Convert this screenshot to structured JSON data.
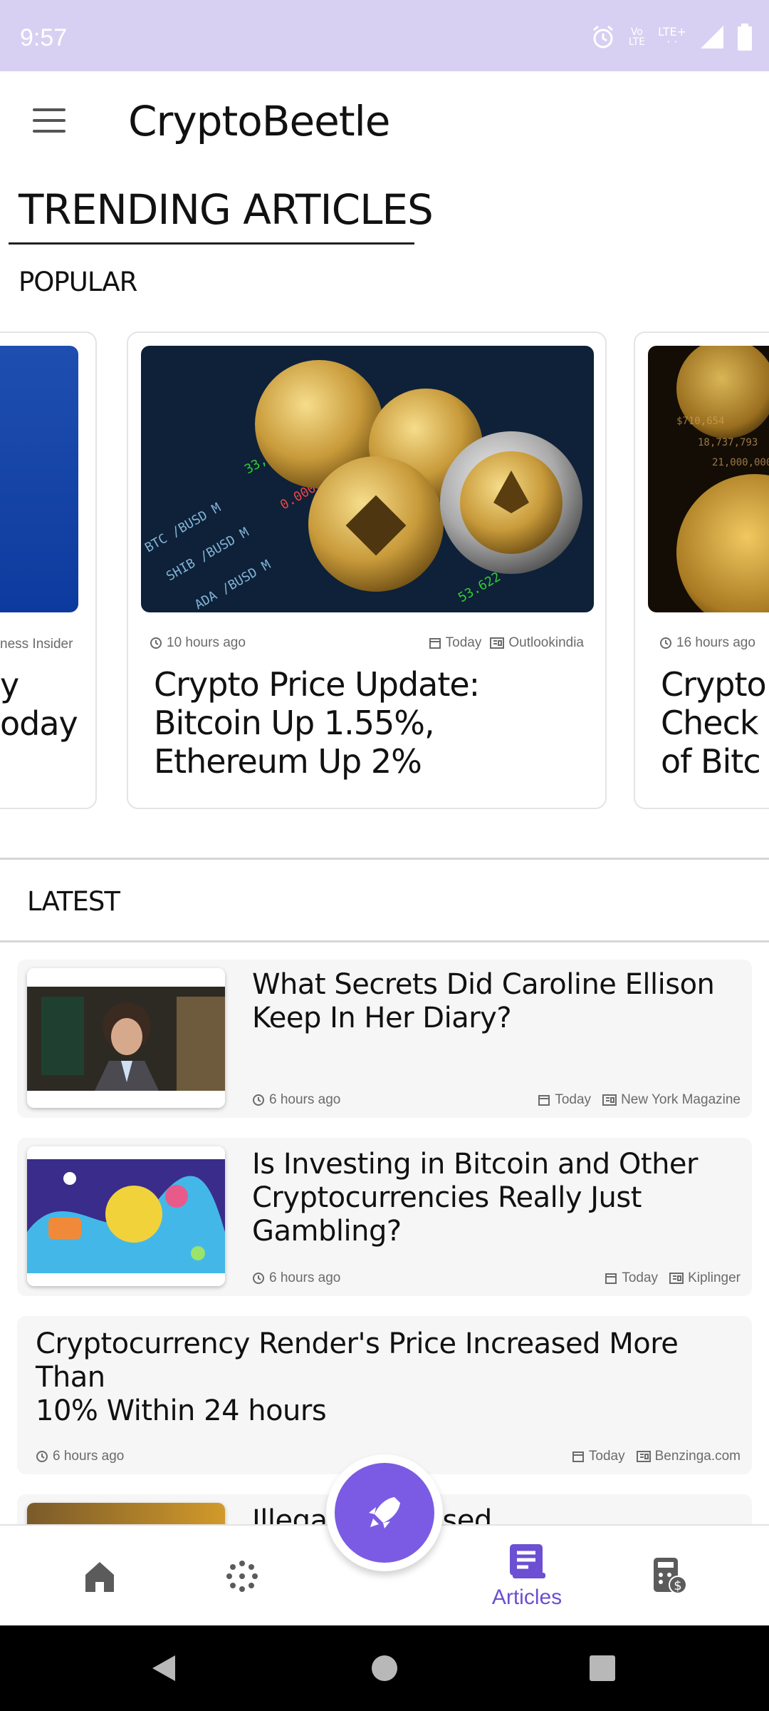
{
  "status_bar": {
    "time": "9:57",
    "volte_line1": "Vo",
    "volte_line2": "LTE",
    "lte_label": "LTE+"
  },
  "app_bar": {
    "title": "CryptoBeetle",
    "menu_icon": "menu-icon"
  },
  "section": {
    "title": "TRENDING ARTICLES",
    "popular_label": "POPULAR",
    "latest_label": "LATEST"
  },
  "popular": [
    {
      "source": "ness Insider",
      "headline_line1": "y",
      "headline_line2": "oday"
    },
    {
      "time_ago": "10 hours ago",
      "date": "Today",
      "source": "Outlookindia",
      "headline_line1": "Crypto Price Update:",
      "headline_line2": "Bitcoin Up 1.55%,",
      "headline_line3": "Ethereum Up 2%"
    },
    {
      "time_ago": "16 hours ago",
      "headline_line1": "Crypto",
      "headline_line2": "Check",
      "headline_line3": "of Bitc"
    }
  ],
  "latest": [
    {
      "title_line1": "What Secrets Did Caroline Ellison",
      "title_line2": "Keep In Her Diary?",
      "time_ago": "6 hours ago",
      "date": "Today",
      "source": "New York Magazine"
    },
    {
      "title_line1": "Is Investing in Bitcoin and Other",
      "title_line2": "Cryptocurrencies Really Just",
      "title_line3": "Gambling?",
      "time_ago": "6 hours ago",
      "date": "Today",
      "source": "Kiplinger"
    },
    {
      "title_line1": "Cryptocurrency Render's Price Increased More Than",
      "title_line2": "10% Within 24 hours",
      "time_ago": "6 hours ago",
      "date": "Today",
      "source": "Benzinga.com"
    },
    {
      "title_partial": "Illegal ATMs used"
    }
  ],
  "bottom_nav": {
    "items": [
      {
        "name": "home",
        "icon": "home-icon",
        "label": ""
      },
      {
        "name": "explore",
        "icon": "sparkle-icon",
        "label": ""
      },
      {
        "name": "articles",
        "icon": "articles-icon",
        "label": "Articles"
      },
      {
        "name": "wallet",
        "icon": "calculator-dollar-icon",
        "label": ""
      }
    ],
    "fab_icon": "rocket-icon",
    "accent_color": "#7b5be3"
  }
}
